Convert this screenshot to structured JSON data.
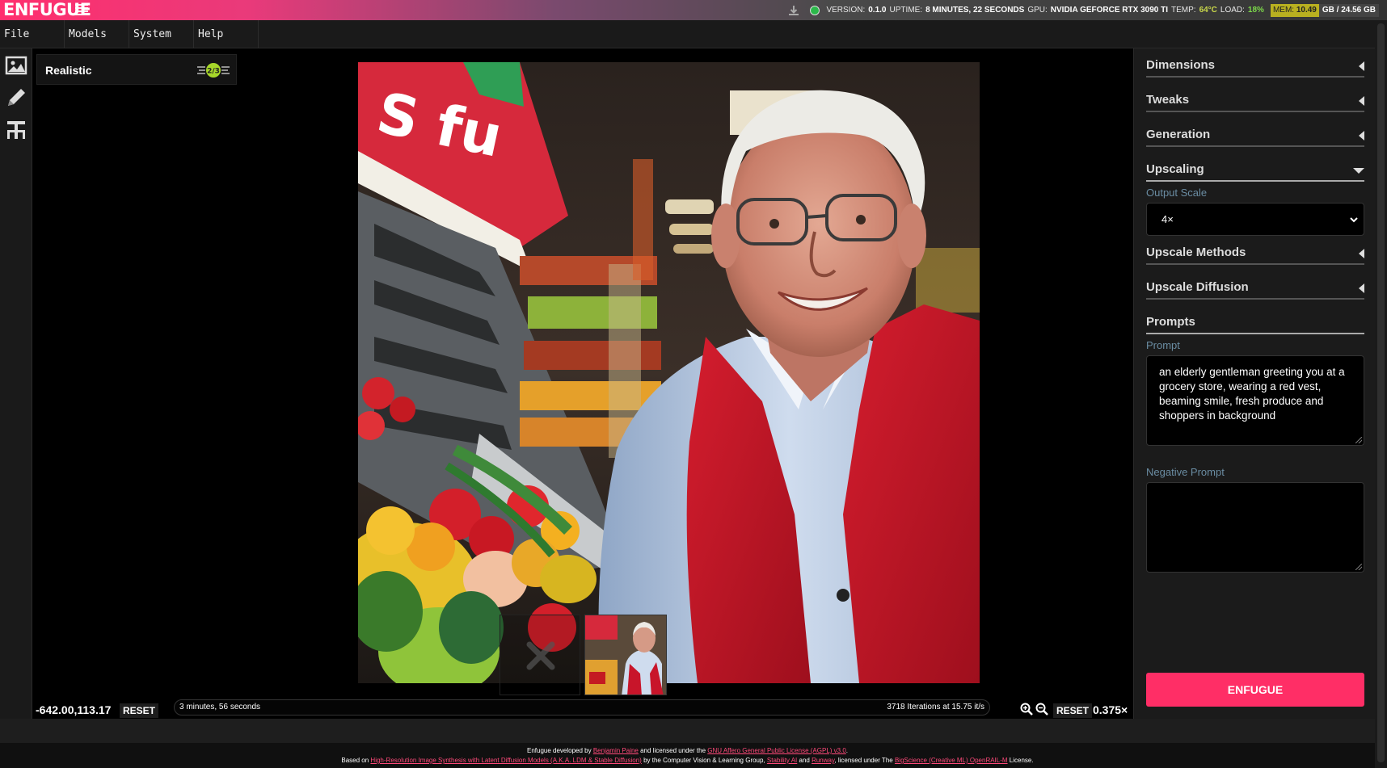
{
  "header": {
    "logo": "ENFUGUE",
    "version_label": "VERSION:",
    "version": "0.1.0",
    "uptime_label": "UPTIME:",
    "uptime": "8 MINUTES, 22 SECONDS",
    "gpu_label": "GPU:",
    "gpu": "NVIDIA GEFORCE RTX 3090 TI",
    "temp_label": "TEMP:",
    "temp": "64°C",
    "load_label": "LOAD:",
    "load": "18%",
    "mem_label": "MEM:",
    "mem_used": "10.49",
    "mem_rest": "GB / 24.56 GB",
    "mem_fraction": 0.427,
    "status_color": "#2bb84a"
  },
  "menu": {
    "file": "File",
    "models": "Models",
    "system": "System",
    "help": "Help"
  },
  "toolbar": {
    "icons": [
      "image-icon",
      "pencil-icon",
      "text-tool-icon"
    ]
  },
  "canvas": {
    "model_name": "Realistic",
    "coords": "-642.00,113.17",
    "reset_label": "RESET",
    "elapsed": "3 minutes, 56 seconds",
    "iterations": "3718 Iterations at 15.75 it/s",
    "zoom_reset_label": "RESET",
    "zoom_level": "0.375×"
  },
  "panel": {
    "sections": {
      "dimensions": "Dimensions",
      "tweaks": "Tweaks",
      "generation": "Generation",
      "upscaling": "Upscaling",
      "upscale_methods": "Upscale Methods",
      "upscale_diffusion": "Upscale Diffusion",
      "prompts": "Prompts"
    },
    "output_scale_label": "Output Scale",
    "output_scale_value": "4×",
    "prompt_label": "Prompt",
    "prompt_value": "an elderly gentleman greeting you at a grocery store, wearing a red vest, beaming smile, fresh produce and shoppers in background",
    "negative_prompt_label": "Negative Prompt",
    "negative_prompt_value": "",
    "submit_label": "ENFUGUE"
  },
  "footer": {
    "l1_a": "Enfugue developed by ",
    "l1_link1": "Benjamin Paine",
    "l1_b": " and licensed under the ",
    "l1_link2": "GNU Affero General Public License (AGPL) v3.0",
    "l1_c": ".",
    "l2_a": "Based on ",
    "l2_link1": "High-Resolution Image Synthesis with Latent Diffusion Models (A.K.A. LDM & Stable Diffusion)",
    "l2_b": " by the Computer Vision & Learning Group, ",
    "l2_link2": "Stability AI",
    "l2_c": " and ",
    "l2_link3": "Runway",
    "l2_d": ", licensed under The ",
    "l2_link4": "BigScience (Creative ML) OpenRAIL-M",
    "l2_e": " License."
  },
  "colors": {
    "accent": "#ff2e66",
    "label_blue": "#6a8ca2",
    "vest_red": "#c8152a"
  }
}
